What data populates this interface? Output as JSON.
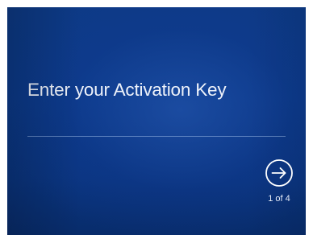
{
  "activation": {
    "title": "Enter your Activation Key",
    "step_indicator": "1 of 4",
    "next_icon": "arrow-right-circle-icon"
  },
  "colors": {
    "background": "#0b3a8a",
    "text": "#eef2fa",
    "divider": "#96b4e1"
  }
}
